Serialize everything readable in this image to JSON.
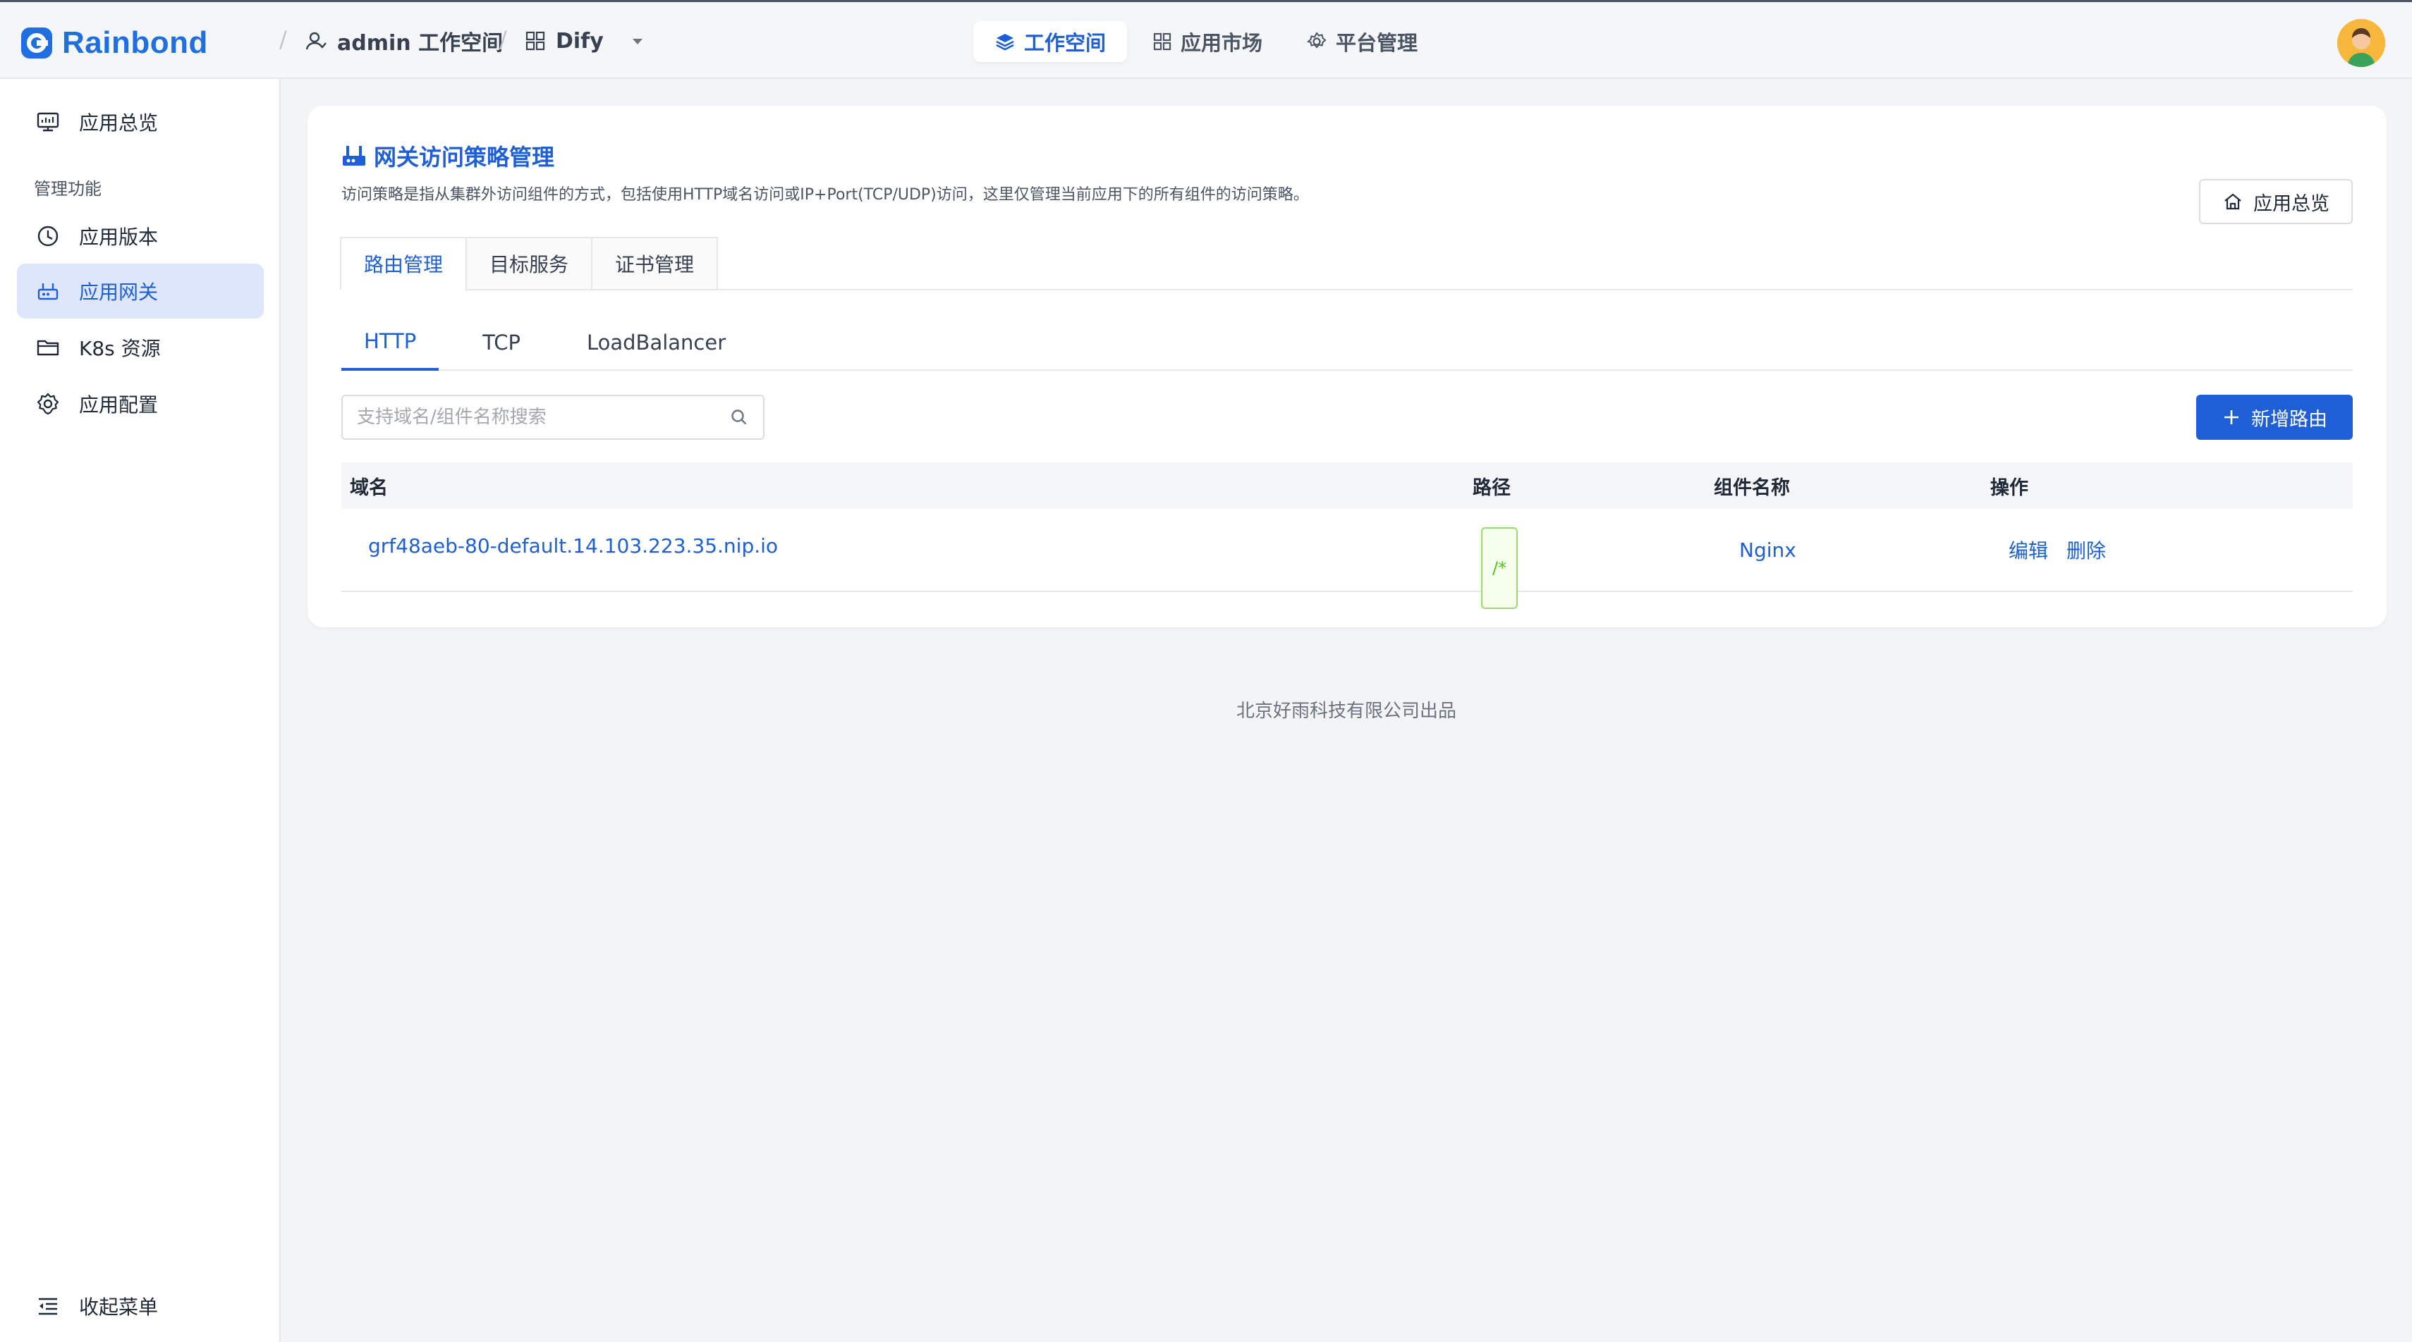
{
  "brand": {
    "name": "Rainbond",
    "accent": "#1f6fe0"
  },
  "breadcrumb": {
    "workspace": "admin 工作空间",
    "app": "Dify"
  },
  "topnav": [
    {
      "label": "工作空间",
      "icon": "layers-icon",
      "active": true
    },
    {
      "label": "应用市场",
      "icon": "grid-icon",
      "active": false
    },
    {
      "label": "平台管理",
      "icon": "gear-icon",
      "active": false
    }
  ],
  "sidebar": {
    "overview": "应用总览",
    "section": "管理功能",
    "items": [
      {
        "label": "应用版本",
        "icon": "clock-icon"
      },
      {
        "label": "应用网关",
        "icon": "gateway-icon",
        "active": true
      },
      {
        "label": "K8s 资源",
        "icon": "folder-icon"
      },
      {
        "label": "应用配置",
        "icon": "gear-icon"
      }
    ],
    "collapse": "收起菜单"
  },
  "card": {
    "title": "网关访问策略管理",
    "description": "访问策略是指从集群外访问组件的方式，包括使用HTTP域名访问或IP+Port(TCP/UDP)访问，这里仅管理当前应用下的所有组件的访问策略。",
    "overview_button": "应用总览",
    "box_tabs": [
      "路由管理",
      "目标服务",
      "证书管理"
    ],
    "line_tabs": [
      "HTTP",
      "TCP",
      "LoadBalancer"
    ],
    "search_placeholder": "支持域名/组件名称搜索",
    "add_button": "新增路由",
    "table": {
      "headers": [
        "域名",
        "路径",
        "组件名称",
        "操作"
      ],
      "rows": [
        {
          "domain": "grf48aeb-80-default.14.103.223.35.nip.io",
          "path": "/*",
          "component": "Nginx",
          "actions": [
            "编辑",
            "删除"
          ]
        }
      ]
    }
  },
  "footer": "北京好雨科技有限公司出品",
  "colors": {
    "primary": "#1f5fd6",
    "success": "#52c41a",
    "background": "#f3f4f6"
  }
}
